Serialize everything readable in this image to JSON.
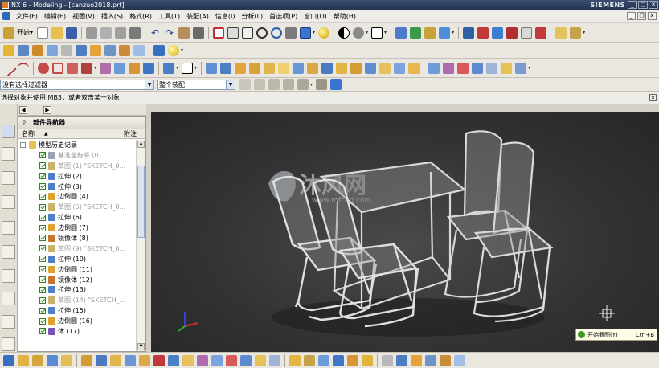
{
  "window": {
    "title": "NX 6 - Modeling - [canzuo2018.prt]",
    "brand": "SIEMENS"
  },
  "menubar": {
    "items": [
      "文件(F)",
      "编辑(E)",
      "视图(V)",
      "插入(S)",
      "格式(R)",
      "工具(T)",
      "装配(A)",
      "信息(I)",
      "分析(L)",
      "首选项(P)",
      "窗口(O)",
      "帮助(H)"
    ]
  },
  "toolbar": {
    "start_label": "开始▾"
  },
  "filterbar": {
    "type_filter": "没有选择过滤器",
    "scope_filter": "整个装配"
  },
  "cue_line": "选择对象并使用 MB3，或者双击某一对象",
  "navigator": {
    "title": "部件导航器",
    "col_name": "名称",
    "col_comment": "附注",
    "root": "模型历史记录",
    "rows": [
      {
        "label": "基准坐标系 (0)",
        "inactive": true,
        "icon": "datum-icon"
      },
      {
        "label": "草图 (1) \"SKETCH_0...",
        "inactive": true,
        "icon": "sketch-icon"
      },
      {
        "label": "拉伸 (2)",
        "inactive": false,
        "icon": "extrude-icon"
      },
      {
        "label": "拉伸 (3)",
        "inactive": false,
        "icon": "extrude-icon"
      },
      {
        "label": "边倒圆 (4)",
        "inactive": false,
        "icon": "blend-icon"
      },
      {
        "label": "草图 (5) \"SKETCH_0...",
        "inactive": true,
        "icon": "sketch-icon"
      },
      {
        "label": "拉伸 (6)",
        "inactive": false,
        "icon": "extrude-icon"
      },
      {
        "label": "边倒圆 (7)",
        "inactive": false,
        "icon": "blend-icon"
      },
      {
        "label": "镜像体 (8)",
        "inactive": false,
        "icon": "mirror-icon"
      },
      {
        "label": "草图 (9) \"SKETCH_0...",
        "inactive": true,
        "icon": "sketch-icon"
      },
      {
        "label": "拉伸 (10)",
        "inactive": false,
        "icon": "extrude-icon"
      },
      {
        "label": "边倒圆 (11)",
        "inactive": false,
        "icon": "blend-icon"
      },
      {
        "label": "镜像体 (12)",
        "inactive": false,
        "icon": "mirror-icon"
      },
      {
        "label": "拉伸 (13)",
        "inactive": false,
        "icon": "extrude-icon"
      },
      {
        "label": "草图 (14) \"SKETCH_...",
        "inactive": true,
        "icon": "sketch-icon"
      },
      {
        "label": "拉伸 (15)",
        "inactive": false,
        "icon": "extrude-icon"
      },
      {
        "label": "边倒圆 (16)",
        "inactive": false,
        "icon": "blend-icon"
      },
      {
        "label": "体 (17)",
        "inactive": false,
        "icon": "body-icon"
      }
    ]
  },
  "watermark": {
    "text": "沐风网",
    "url": "www.mfcad.com"
  },
  "command_tip": {
    "label": "开始截图(Y)",
    "shortcut": "Ctrl+B"
  },
  "colors": {
    "viewport_bg": "#333333",
    "model_stroke": "#d8d8d8",
    "glass_fill": "#8a8a8a",
    "check_green": "#2e8b1e"
  }
}
